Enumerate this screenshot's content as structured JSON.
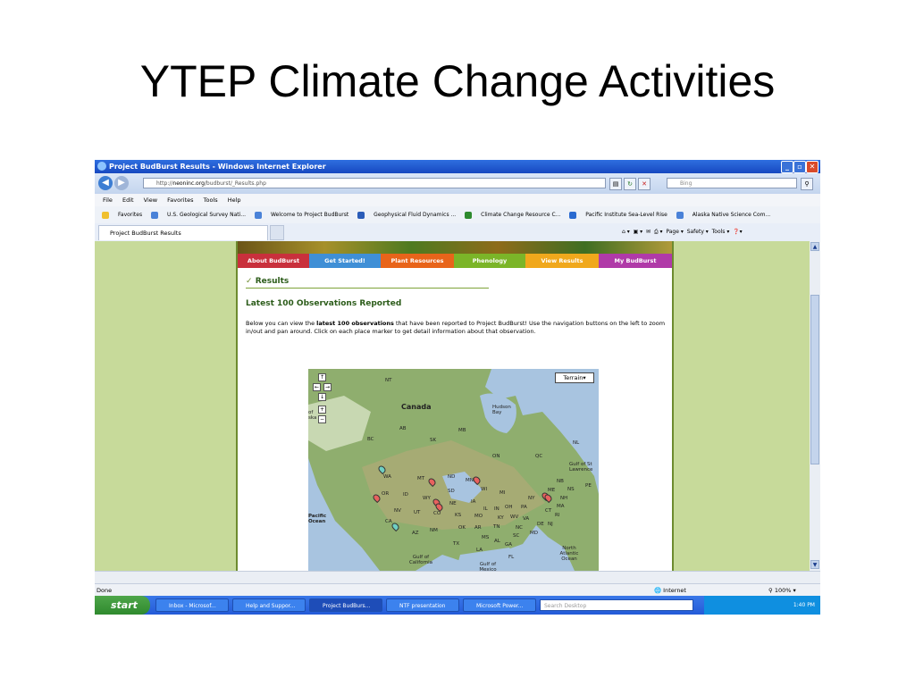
{
  "slide": {
    "title": "YTEP Climate Change Activities"
  },
  "window": {
    "title": "Project BudBurst Results - Windows Internet Explorer",
    "tab_label": "Project BudBurst Results"
  },
  "address": {
    "url_prefix": "http://",
    "url_domain": "neoninc.org",
    "url_path": "/budburst/_Results.php",
    "search_placeholder": "Bing"
  },
  "menu": [
    "File",
    "Edit",
    "View",
    "Favorites",
    "Tools",
    "Help"
  ],
  "favorites": {
    "label": "Favorites",
    "items": [
      "U.S. Geological Survey Nati...",
      "Welcome to Project BudBurst",
      "Geophysical Fluid Dynamics ...",
      "Climate Change Resource C...",
      "Pacific Institute Sea-Level Rise",
      "Alaska Native Science Com..."
    ]
  },
  "commandbar": {
    "page": "Page ▾",
    "safety": "Safety ▾",
    "tools": "Tools ▾"
  },
  "site": {
    "nav": [
      {
        "label": "About BudBurst",
        "color": "#c9303c"
      },
      {
        "label": "Get Started!",
        "color": "#3f8fd6"
      },
      {
        "label": "Plant Resources",
        "color": "#e8641a"
      },
      {
        "label": "Phenology",
        "color": "#7bb528"
      },
      {
        "label": "View Results",
        "color": "#f0a81c"
      },
      {
        "label": "My BudBurst",
        "color": "#b03aa8"
      }
    ],
    "results_heading": "Results",
    "latest_heading": "Latest 100 Observations Reported",
    "para_before": "Below you can view the ",
    "para_bold": "latest 100 observations",
    "para_after": " that have been reported to Project BudBurst! Use the navigation buttons on the left to zoom in/out and pan around. Click on each place marker to get detail information about that observation."
  },
  "map": {
    "type_button": "Terrain▾",
    "labels": [
      "NT",
      "Hudson Bay",
      "Canada",
      "AB",
      "SK",
      "MB",
      "BC",
      "ON",
      "QC",
      "NL",
      "Gulf of St Lawrence",
      "WA",
      "MT",
      "ND",
      "MN",
      "OR",
      "ID",
      "SD",
      "WI",
      "MI",
      "NB",
      "PE",
      "NS",
      "ME",
      "NH",
      "WY",
      "NE",
      "IA",
      "NY",
      "MA",
      "CT",
      "RI",
      "NV",
      "UT",
      "CO",
      "KS",
      "MO",
      "IL",
      "IN",
      "OH",
      "PA",
      "NJ",
      "DE",
      "MD",
      "CA",
      "AZ",
      "NM",
      "OK",
      "AR",
      "TN",
      "KY",
      "WV",
      "VA",
      "NC",
      "SC",
      "MS",
      "AL",
      "GA",
      "TX",
      "LA",
      "FL",
      "Pacific Ocean",
      "North Atlantic Ocean",
      "Gulf of California",
      "Gulf of Mexico",
      "of ska"
    ],
    "marker_colors": [
      "#e8625e",
      "#6fcfc2"
    ]
  },
  "status": {
    "left": "Done",
    "zone": "Internet",
    "zoom": "100%"
  },
  "taskbar": {
    "start": "start",
    "buttons": [
      "Inbox - Microsof...",
      "Help and Suppor...",
      "Project BudBurs...",
      "NTF presentation",
      "Microsoft Power..."
    ],
    "search_placeholder": "Search Desktop",
    "time": "1:40 PM"
  }
}
